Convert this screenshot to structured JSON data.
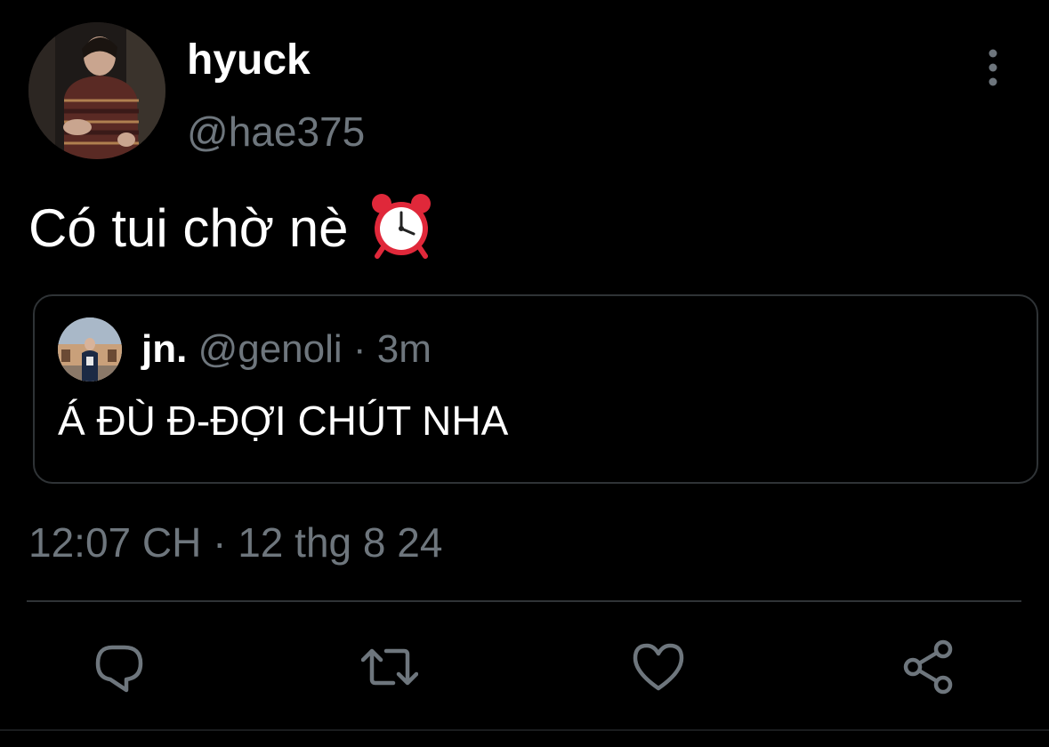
{
  "tweet": {
    "author": {
      "display_name": "hyuck",
      "handle": "@hae375"
    },
    "text": "Có tui chờ nè",
    "emoji": "alarm-clock-icon",
    "quoted": {
      "display_name": "jn.",
      "handle": "@genoli",
      "separator": "·",
      "time": "3m",
      "text": "Á ĐÙ Đ-ĐỢI CHÚT NHA"
    },
    "timestamp": "12:07 CH · 12 thg 8 24"
  },
  "actions": [
    {
      "icon": "reply-icon"
    },
    {
      "icon": "retweet-icon"
    },
    {
      "icon": "like-icon"
    },
    {
      "icon": "share-icon"
    }
  ],
  "colors": {
    "background": "#000000",
    "primary_text": "#ffffff",
    "secondary_text": "#6e767d",
    "border": "#2f3336",
    "clock_red": "#e0283a"
  }
}
